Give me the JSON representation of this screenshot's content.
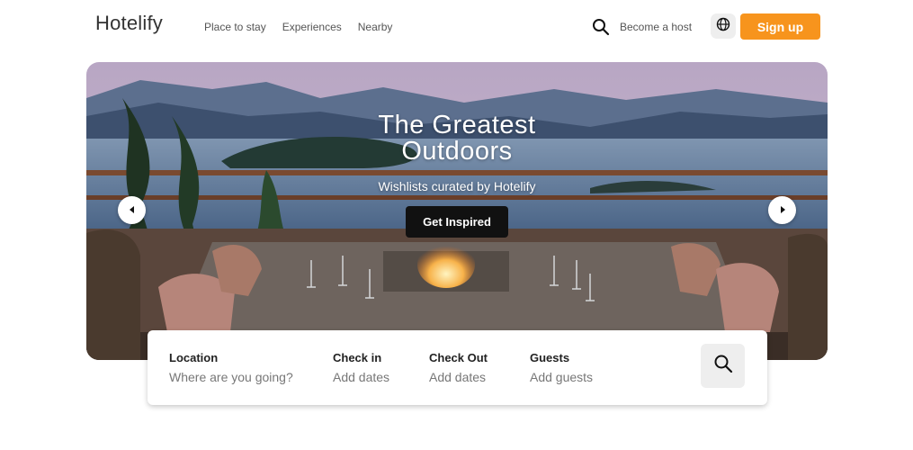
{
  "header": {
    "logo": "Hotelify",
    "nav": [
      "Place to stay",
      "Experiences",
      "Nearby"
    ],
    "become_host": "Become a host",
    "signup": "Sign up",
    "accent_color": "#f7941d"
  },
  "hero": {
    "title_line1": "The Greatest",
    "title_line2": "Outdoors",
    "subtitle": "Wishlists curated by Hotelify",
    "cta": "Get Inspired"
  },
  "search": {
    "location": {
      "label": "Location",
      "placeholder": "Where are you going?"
    },
    "check_in": {
      "label": "Check in",
      "placeholder": "Add dates"
    },
    "check_out": {
      "label": "Check Out",
      "placeholder": "Add dates"
    },
    "guests": {
      "label": "Guests",
      "placeholder": "Add guests"
    }
  },
  "icons": {
    "search": "search-icon",
    "globe": "globe-icon",
    "prev": "chevron-left-icon",
    "next": "chevron-right-icon"
  }
}
